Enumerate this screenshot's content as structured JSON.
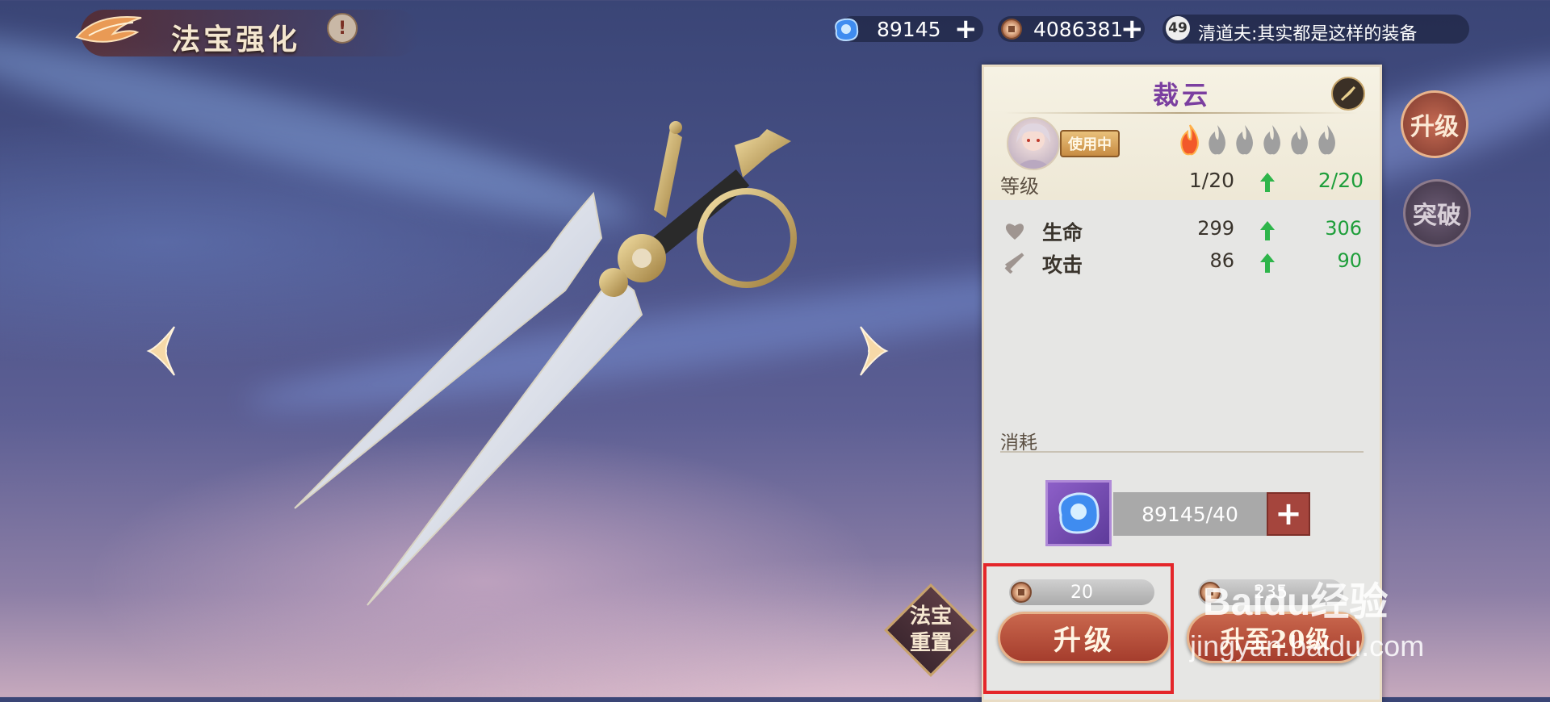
{
  "header": {
    "title": "法宝强化",
    "info_icon_text": "!"
  },
  "resources": {
    "crystal": {
      "value": "89145",
      "icon": "blue-crystal-icon"
    },
    "coin": {
      "value": "4086381",
      "icon": "copper-coin-icon"
    },
    "add_symbol": "+"
  },
  "chat": {
    "level_badge": "49",
    "message": "清道夫:其实都是这样的装备"
  },
  "weapon": {
    "name": "裁云",
    "status_badge": "使用中",
    "flames_total": 6,
    "flames_lit": 1,
    "level_label": "等级",
    "level_current": "1/20",
    "level_next": "2/20"
  },
  "stats": [
    {
      "label": "生命",
      "current": "299",
      "next": "306",
      "icon": "heart-icon"
    },
    {
      "label": "攻击",
      "current": "86",
      "next": "90",
      "icon": "sword-icon"
    }
  ],
  "cost": {
    "label": "消耗",
    "material_amount": "89145/40",
    "add_symbol": "+"
  },
  "actions": {
    "upgrade_cost": "20",
    "upgrade_label": "升级",
    "upgrade_all_cost": "235",
    "upgrade_all_label": "升至20级",
    "reset_label_line1": "法宝",
    "reset_label_line2": "重置"
  },
  "side_tabs": {
    "upgrade": "升级",
    "breakthrough": "突破"
  },
  "watermark": {
    "brand": "Baidu经验",
    "url": "jingyan.baidu.com"
  },
  "colors": {
    "highlight_border": "#e4262a",
    "gain_green": "#1e9e3a",
    "name_purple": "#7b3fa0",
    "button_red": "#a53d2d"
  }
}
